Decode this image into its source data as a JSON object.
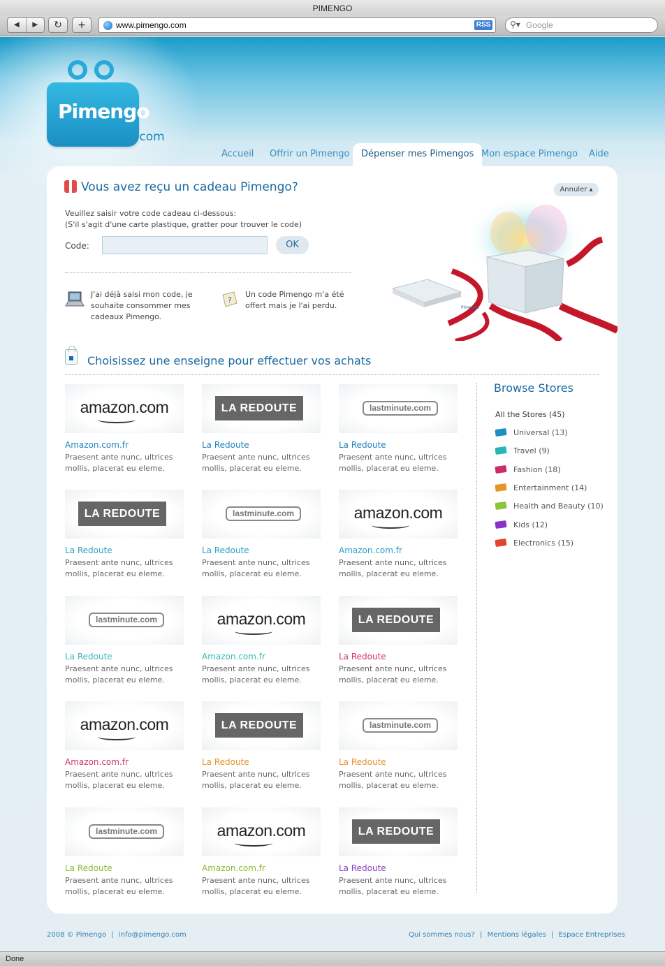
{
  "browser": {
    "window_title": "PIMENGO",
    "url": "www.pimengo.com",
    "rss_label": "RSS",
    "search_placeholder": "Google",
    "status": "Done"
  },
  "logo": {
    "word": "Pimengo",
    "suffix": ".com"
  },
  "nav": {
    "items": [
      {
        "label": "Accueil"
      },
      {
        "label": "Offrir un Pimengo"
      },
      {
        "label": "Dépenser mes Pimengos"
      },
      {
        "label": "Mon espace Pimengo"
      },
      {
        "label": "Aide"
      }
    ],
    "active_index": 2
  },
  "gift": {
    "title": "Vous avez reçu un cadeau Pimengo?",
    "annuler": "Annuler",
    "instruction_line1": "Veuillez saisir votre code cadeau ci-dessous:",
    "instruction_line2": "(S'il s'agit d'une carte plastique, gratter pour trouver le code)",
    "code_label": "Code:",
    "code_value": "",
    "ok": "OK",
    "option1_line1": "J'ai déjà saisi mon code, je",
    "option1_line2": "souhaite consommer mes",
    "option1_line3": "cadeaux Pimengo.",
    "option2_line1": "Un code Pimengo m'a été",
    "option2_line2": "offert mais je l'ai perdu.",
    "illustration_tag": "Pimengo"
  },
  "stores_section": {
    "title": "Choisissez une enseigne pour effectuer vos achats",
    "desc_line1": "Praesent ante nunc, ultrices",
    "desc_line2": "mollis, placerat eu eleme.",
    "logos": {
      "amazon": "amazon.com",
      "redoute": "LA REDOUTE",
      "lastminute": "lastminute.com"
    },
    "tiles": [
      {
        "logo": "amazon",
        "name": "Amazon.com.fr",
        "color": "#1e7fbf"
      },
      {
        "logo": "redoute",
        "name": "La Redoute",
        "color": "#1e7fbf"
      },
      {
        "logo": "lastminute",
        "name": "La Redoute",
        "color": "#1e7fbf"
      },
      {
        "logo": "redoute",
        "name": "La Redoute",
        "color": "#2aa0c8"
      },
      {
        "logo": "lastminute",
        "name": "La Redoute",
        "color": "#2aa0c8"
      },
      {
        "logo": "amazon",
        "name": "Amazon.com.fr",
        "color": "#2aa0c8"
      },
      {
        "logo": "lastminute",
        "name": "La Redoute",
        "color": "#3ab8b0"
      },
      {
        "logo": "amazon",
        "name": "Amazon.com.fr",
        "color": "#3ab8b0"
      },
      {
        "logo": "redoute",
        "name": "La Redoute",
        "color": "#d0336d"
      },
      {
        "logo": "amazon",
        "name": "Amazon.com.fr",
        "color": "#d0336d"
      },
      {
        "logo": "redoute",
        "name": "La Redoute",
        "color": "#e5942a"
      },
      {
        "logo": "lastminute",
        "name": "La Redoute",
        "color": "#e5942a"
      },
      {
        "logo": "lastminute",
        "name": "La Redoute",
        "color": "#8cba2f"
      },
      {
        "logo": "amazon",
        "name": "Amazon.com.fr",
        "color": "#8cba2f"
      },
      {
        "logo": "redoute",
        "name": "La Redoute",
        "color": "#8a3fbf"
      }
    ]
  },
  "sidebar": {
    "title": "Browse Stores",
    "all": "All the Stores (45)",
    "items": [
      {
        "label": "Universal (13)",
        "color": "#1e8fc4"
      },
      {
        "label": "Travel (9)",
        "color": "#2ab5b5"
      },
      {
        "label": "Fashion (18)",
        "color": "#cf2a6a"
      },
      {
        "label": "Entertainment (14)",
        "color": "#e5942a"
      },
      {
        "label": "Health and Beauty (10)",
        "color": "#8cc43a"
      },
      {
        "label": "Kids (12)",
        "color": "#8a32c8"
      },
      {
        "label": "Electronics (15)",
        "color": "#e0462d"
      }
    ]
  },
  "footer": {
    "copyright": "2008 © Pimengo",
    "email": "info@pimengo.com",
    "links": [
      "Qui sommes nous?",
      "Mentions légales",
      "Espace Entreprises"
    ],
    "separator": "|"
  }
}
